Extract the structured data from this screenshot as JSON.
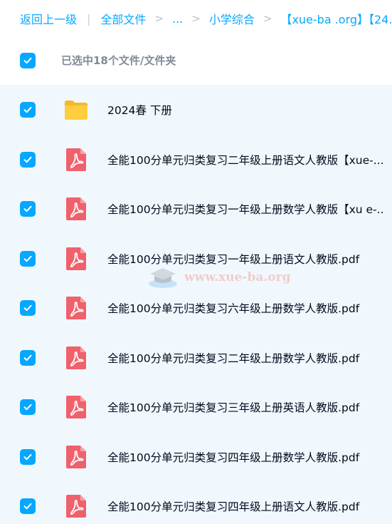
{
  "breadcrumb": {
    "back": "返回上一级",
    "all_files": "全部文件",
    "ellipsis": "...",
    "folder": "小学综合",
    "current": "【xue-ba .org】【24..."
  },
  "selection": {
    "label": "已选中18个文件/文件夹"
  },
  "files": [
    {
      "name": "2024春 下册",
      "type": "folder"
    },
    {
      "name": "全能100分单元归类复习二年级上册语文人教版【xue-...",
      "type": "pdf"
    },
    {
      "name": "全能100分单元归类复习一年级上册数学人教版【xu e-...",
      "type": "pdf"
    },
    {
      "name": "全能100分单元归类复习一年级上册语文人教版.pdf",
      "type": "pdf"
    },
    {
      "name": "全能100分单元归类复习六年级上册数学人教版.pdf",
      "type": "pdf"
    },
    {
      "name": "全能100分单元归类复习二年级上册数学人教版.pdf",
      "type": "pdf"
    },
    {
      "name": "全能100分单元归类复习三年级上册英语人教版.pdf",
      "type": "pdf"
    },
    {
      "name": "全能100分单元归类复习四年级上册数学人教版.pdf",
      "type": "pdf"
    },
    {
      "name": "全能100分单元归类复习四年级上册语文人教版.pdf",
      "type": "pdf"
    }
  ],
  "watermark": "www.xue-ba.org",
  "colors": {
    "accent": "#06a7ff",
    "pdf": "#f0616b",
    "folder": "#ffc93c",
    "list_bg": "#f0f8fe"
  }
}
